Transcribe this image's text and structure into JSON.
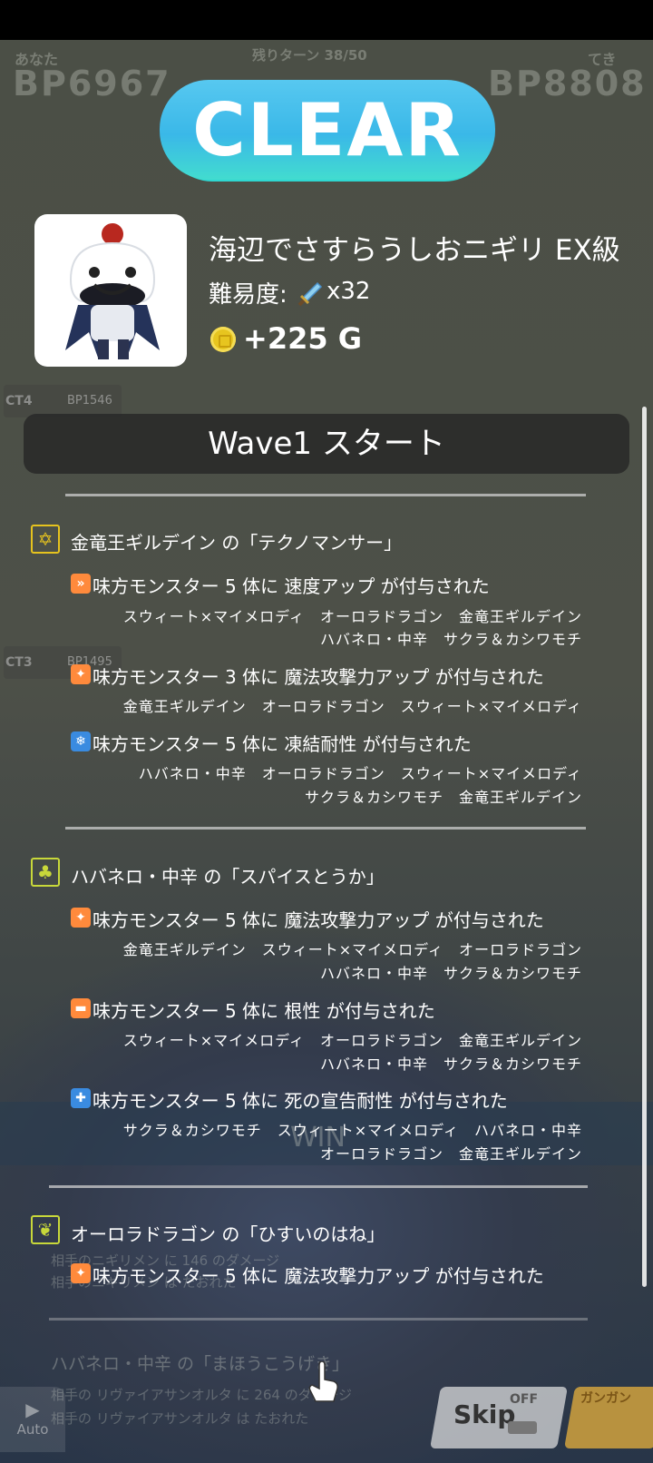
{
  "background": {
    "player_label": "あなた",
    "player_bp": "BP6967",
    "turns_left": "残りターン 38/50",
    "enemy_label": "てき",
    "enemy_bp": "BP8808",
    "ct4": "CT4",
    "ct3": "CT3",
    "bp_a": "BP1546",
    "bp_b": "BP1495",
    "win": "WIN",
    "log1": "相手のニギリメン に 146 のダメージ",
    "log2": "相手のニギリメン は たおれた",
    "log_title": "ハバネロ・中辛 の「まほうこうげき」",
    "log3": "相手の リヴァイアサンオルタ に 264 のダメージ",
    "log4": "相手の リヴァイアサンオルタ は たおれた",
    "auto": "Auto",
    "skip": "Skip",
    "off": "OFF",
    "ganban": "ガンガン"
  },
  "result": {
    "banner": "CLEAR",
    "stage_name": "海辺でさすらうしおニギリ EX級",
    "difficulty_label": "難易度:",
    "difficulty_value": "x32",
    "gold": "+225 G"
  },
  "wave": {
    "title": "Wave1 スタート",
    "skills": [
      {
        "title": "金竜王ギルデイン の「テクノマンサー」",
        "icon": "hexagram-icon",
        "buffs": [
          {
            "text": "味方モンスター 5 体に 速度アップ が付与された",
            "icon": "speed-up-icon",
            "lines": [
              "スウィート×マイメロディ　オーロラドラゴン　金竜王ギルデイン",
              "ハバネロ・中辛　サクラ＆カシワモチ"
            ]
          },
          {
            "text": "味方モンスター 3 体に 魔法攻撃力アップ が付与された",
            "icon": "magic-attack-up-icon",
            "lines": [
              "金竜王ギルデイン　オーロラドラゴン　スウィート×マイメロディ"
            ]
          },
          {
            "text": "味方モンスター 5 体に 凍結耐性 が付与された",
            "icon": "freeze-resist-icon",
            "lines": [
              "ハバネロ・中辛　オーロラドラゴン　スウィート×マイメロディ",
              "サクラ＆カシワモチ　金竜王ギルデイン"
            ]
          }
        ]
      },
      {
        "title": "ハバネロ・中辛 の「スパイスとうか」",
        "icon": "clover-icon",
        "buffs": [
          {
            "text": "味方モンスター 5 体に 魔法攻撃力アップ が付与された",
            "icon": "magic-attack-up-icon",
            "lines": [
              "金竜王ギルデイン　スウィート×マイメロディ　オーロラドラゴン",
              "ハバネロ・中辛　サクラ＆カシワモチ"
            ]
          },
          {
            "text": "味方モンスター 5 体に 根性 が付与された",
            "icon": "guts-icon",
            "lines": [
              "スウィート×マイメロディ　オーロラドラゴン　金竜王ギルデイン",
              "ハバネロ・中辛　サクラ＆カシワモチ"
            ]
          },
          {
            "text": "味方モンスター 5 体に 死の宣告耐性 が付与された",
            "icon": "doom-resist-icon",
            "lines": [
              "サクラ＆カシワモチ　スウィート×マイメロディ　ハバネロ・中辛",
              "オーロラドラゴン　金竜王ギルデイン"
            ]
          }
        ]
      },
      {
        "title": "オーロラドラゴン の「ひすいのはね」",
        "icon": "feather-icon",
        "buffs": [
          {
            "text": "味方モンスター 5 体に 魔法攻撃力アップ が付与された",
            "icon": "magic-attack-up-icon",
            "lines": []
          }
        ]
      }
    ]
  },
  "colors": {
    "accent_yellow": "#e6c31e",
    "buff_orange": "#ff8a3c",
    "resist_blue": "#3a8be0",
    "clear_blue": "#3ab8e8",
    "clear_teal": "#42dccf"
  }
}
